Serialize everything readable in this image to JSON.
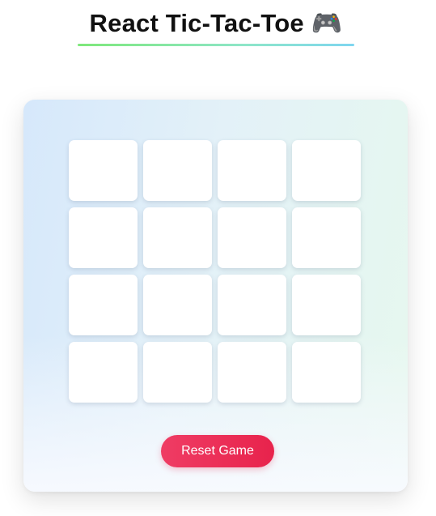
{
  "header": {
    "title": "React Tic-Tac-Toe",
    "emoji": "🎮"
  },
  "board": {
    "rows": 4,
    "cols": 4,
    "cells": [
      [
        "",
        "",
        "",
        ""
      ],
      [
        "",
        "",
        "",
        ""
      ],
      [
        "",
        "",
        "",
        ""
      ],
      [
        "",
        "",
        "",
        ""
      ]
    ]
  },
  "controls": {
    "reset_label": "Reset Game"
  },
  "colors": {
    "reset_button": "#e8234c",
    "title_underline_start": "#7ee87a",
    "title_underline_end": "#7fd6f0"
  }
}
